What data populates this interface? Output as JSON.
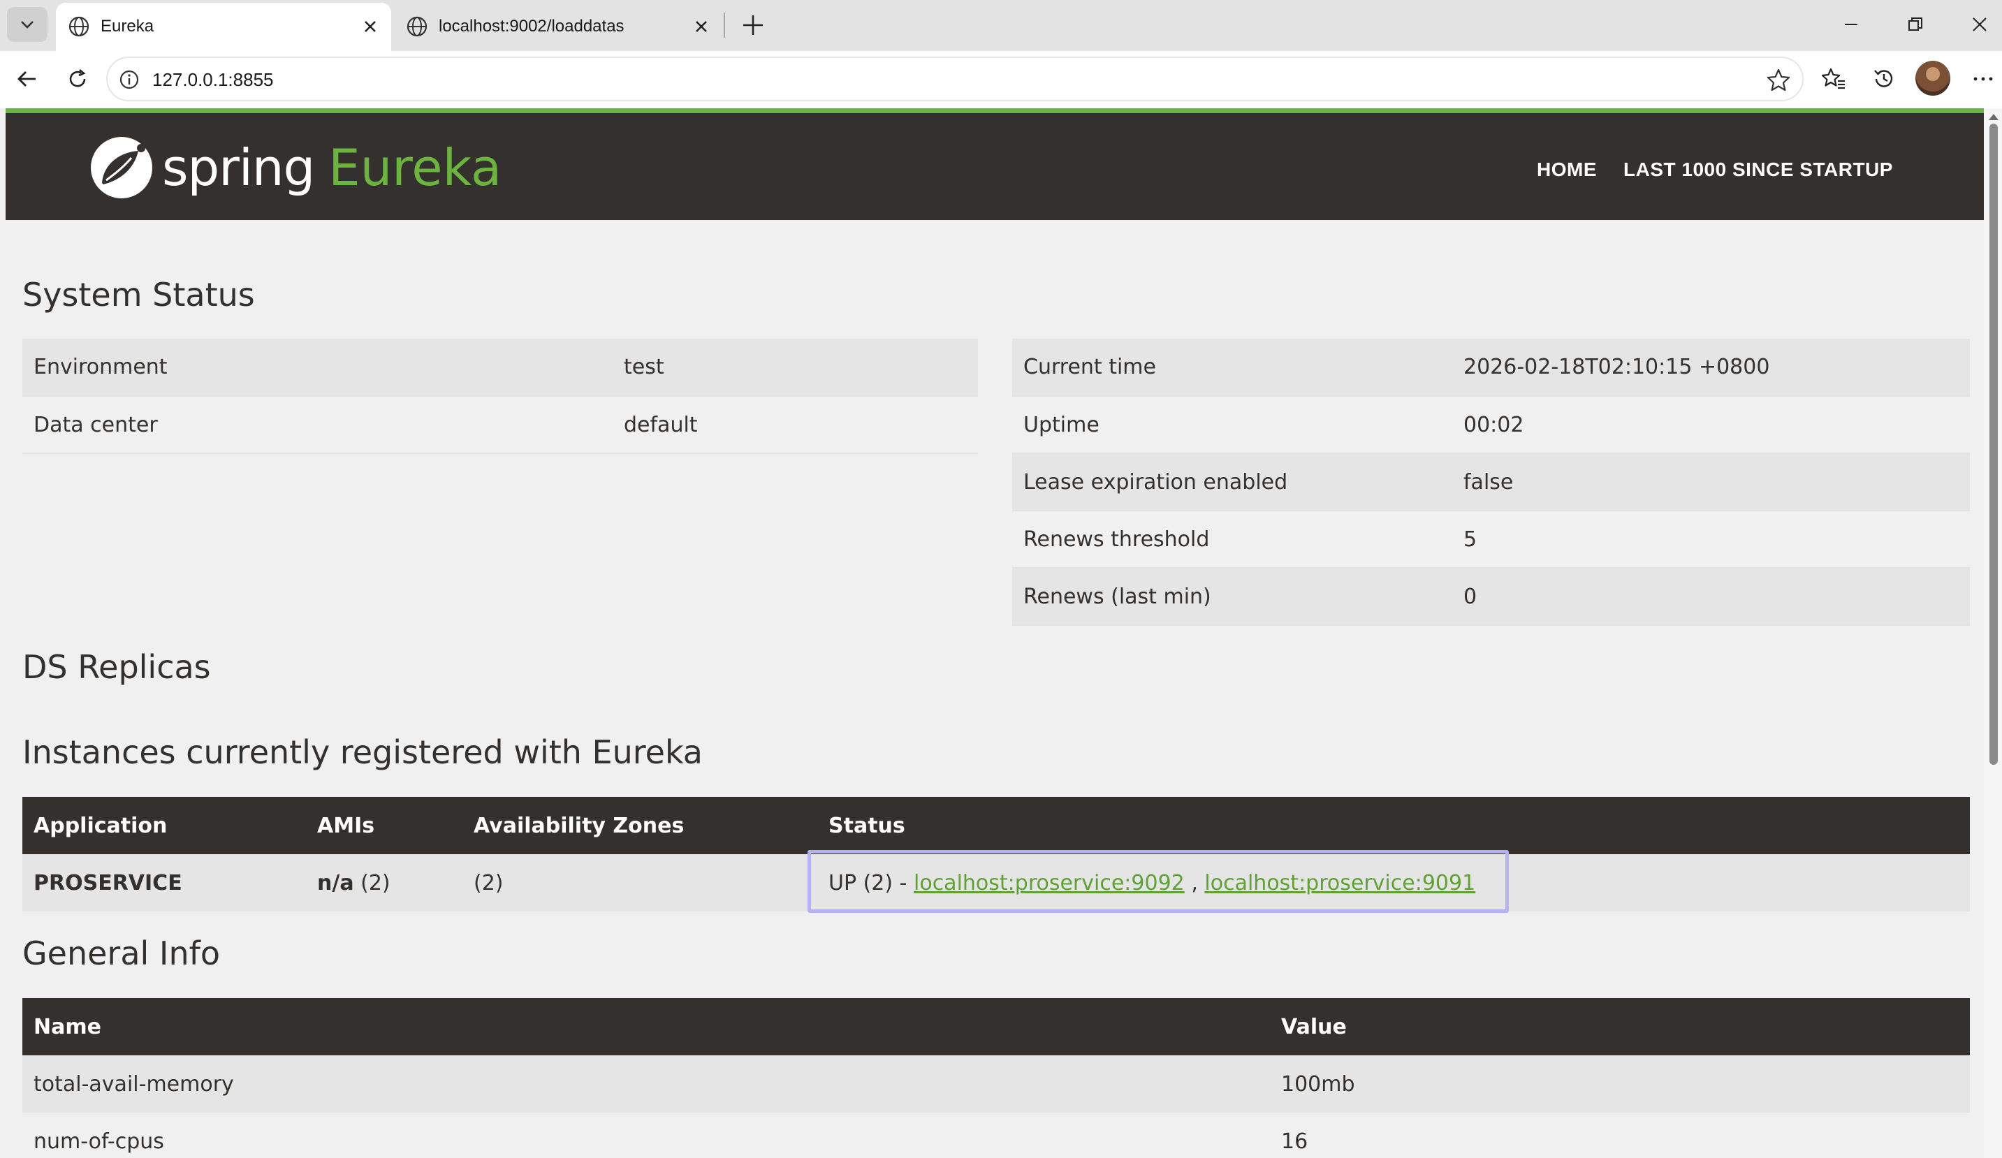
{
  "browser": {
    "tabs": [
      {
        "title": "Eureka",
        "active": true
      },
      {
        "title": "localhost:9002/loaddatas",
        "active": false
      }
    ],
    "address": "127.0.0.1:8855"
  },
  "nav": {
    "logo_spring": "spring",
    "logo_eureka": "Eureka",
    "links": [
      "HOME",
      "LAST 1000 SINCE STARTUP"
    ]
  },
  "system_status": {
    "heading": "System Status",
    "left": [
      {
        "label": "Environment",
        "value": "test"
      },
      {
        "label": "Data center",
        "value": "default"
      }
    ],
    "right": [
      {
        "label": "Current time",
        "value": "2026-02-18T02:10:15 +0800"
      },
      {
        "label": "Uptime",
        "value": "00:02"
      },
      {
        "label": "Lease expiration enabled",
        "value": "false"
      },
      {
        "label": "Renews threshold",
        "value": "5"
      },
      {
        "label": "Renews (last min)",
        "value": "0"
      }
    ]
  },
  "ds_replicas": {
    "heading": "DS Replicas"
  },
  "instances": {
    "heading": "Instances currently registered with Eureka",
    "columns": [
      "Application",
      "AMIs",
      "Availability Zones",
      "Status"
    ],
    "rows": [
      {
        "application": "PROSERVICE",
        "amis_bold": "n/a",
        "amis_count": "(2)",
        "zones": "(2)",
        "status_prefix": "UP (2) -",
        "links": [
          "localhost:proservice:9092",
          "localhost:proservice:9091"
        ],
        "separator": ","
      }
    ]
  },
  "general_info": {
    "heading": "General Info",
    "columns": [
      "Name",
      "Value"
    ],
    "rows": [
      {
        "name": "total-avail-memory",
        "value": "100mb"
      },
      {
        "name": "num-of-cpus",
        "value": "16"
      }
    ]
  },
  "colors": {
    "nav_bg": "#34302d",
    "accent_green": "#6db33f",
    "link_green": "#5fa134",
    "highlight": "#b4b2f5"
  }
}
